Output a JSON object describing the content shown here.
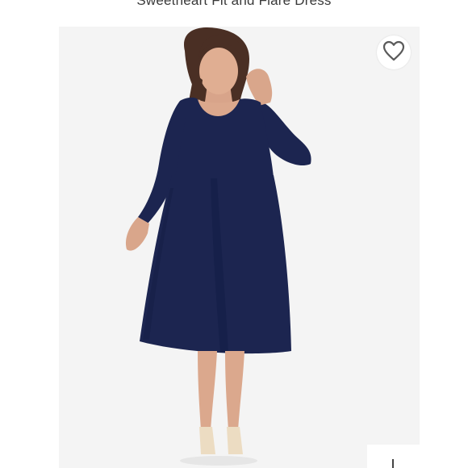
{
  "product": {
    "title": "Sweetheart Fit and Flare Dress"
  },
  "image": {
    "subject": "model-wearing-navy-dress",
    "dress_color": "#1c2550",
    "background_color": "#f4f4f4"
  },
  "wishlist": {
    "icon": "heart-outline-icon"
  }
}
